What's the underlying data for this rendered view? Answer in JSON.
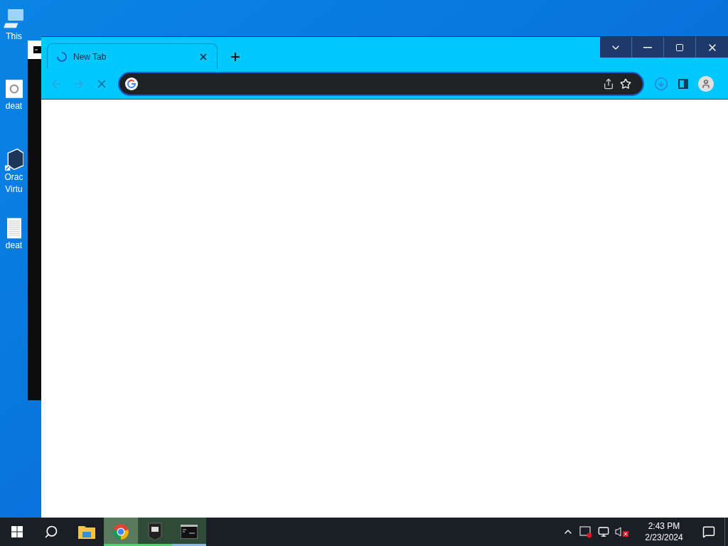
{
  "desktop_icons": [
    {
      "kind": "computer",
      "lines": [
        "This"
      ]
    },
    {
      "kind": "settings-file",
      "lines": [
        "deat"
      ]
    },
    {
      "kind": "virtualbox",
      "lines": [
        "Orac",
        "Virtu"
      ]
    },
    {
      "kind": "text-file",
      "lines": [
        "deat"
      ]
    }
  ],
  "browser": {
    "tabs": [
      {
        "title": "New Tab",
        "loading": true,
        "selected": true
      }
    ]
  },
  "taskbar": {
    "apps": [
      {
        "kind": "explorer",
        "running": false,
        "selected": false
      },
      {
        "kind": "chrome",
        "running": true,
        "selected": true
      },
      {
        "kind": "epic",
        "running": true,
        "selected": false
      },
      {
        "kind": "console",
        "running": true,
        "selected": false
      }
    ],
    "time": "2:43 PM",
    "date": "2/23/2024"
  }
}
